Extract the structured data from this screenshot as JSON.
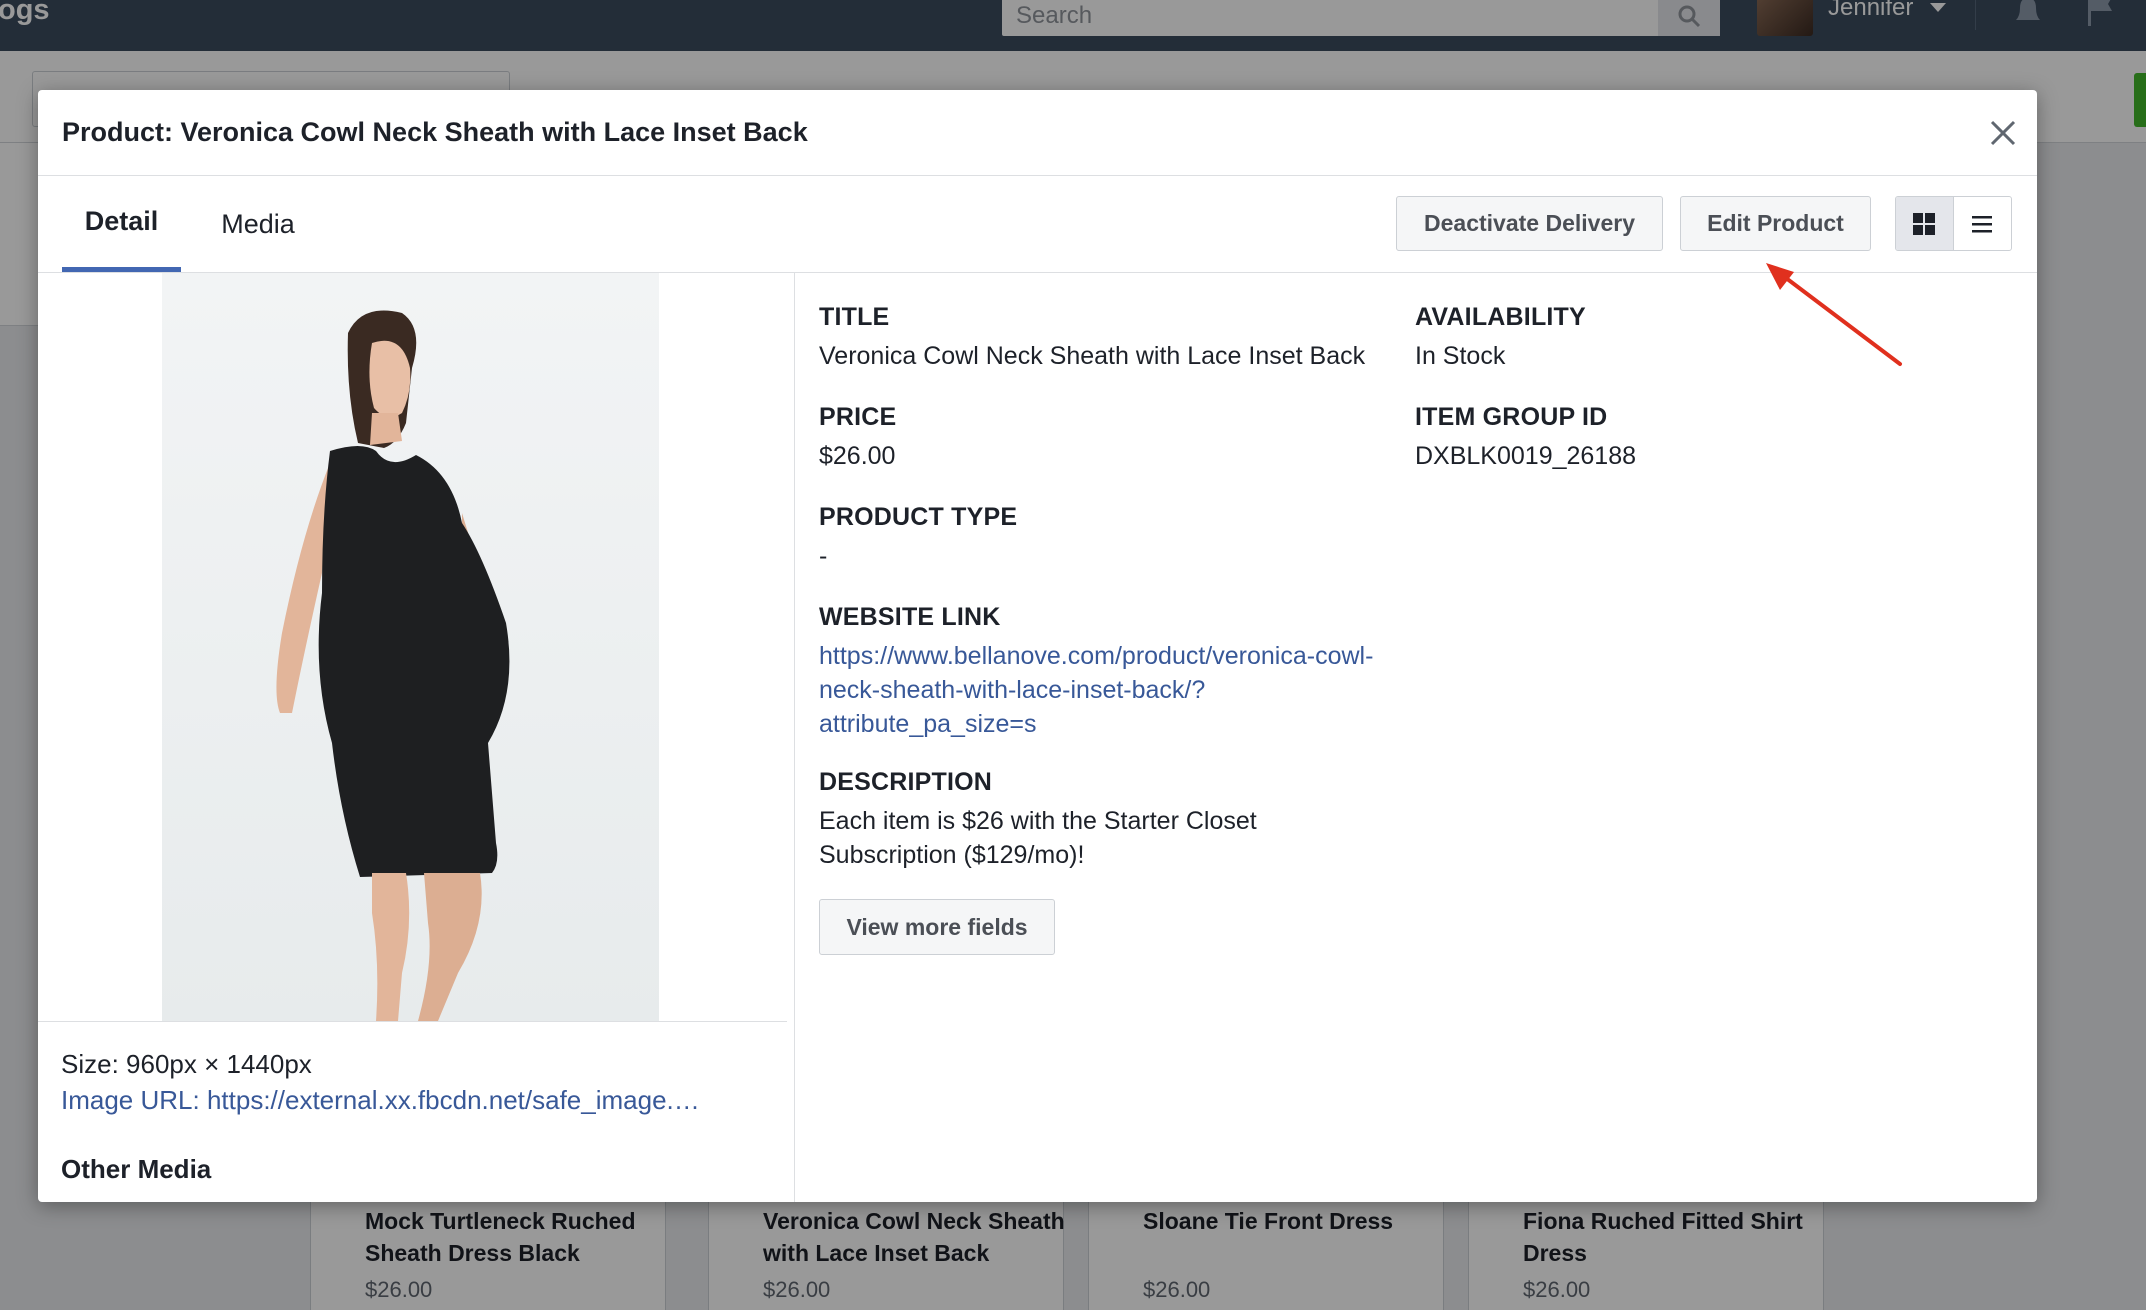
{
  "app": {
    "brand_fragment": "ogs",
    "search_placeholder": "Search",
    "user_name": "Jennifer"
  },
  "modal": {
    "title": "Product: Veronica Cowl Neck Sheath with Lace Inset Back",
    "tabs": [
      {
        "label": "Detail",
        "active": true
      },
      {
        "label": "Media",
        "active": false
      }
    ],
    "buttons": {
      "deactivate": "Deactivate Delivery",
      "edit": "Edit Product",
      "view_more": "View more fields"
    },
    "view_mode": "grid",
    "image": {
      "size_label": "Size: 960px × 1440px",
      "url_label": "Image URL: https://external.xx.fbcdn.net/safe_image.…",
      "other_media_label": "Other Media"
    },
    "fields": {
      "title_label": "TITLE",
      "title_value": "Veronica Cowl Neck Sheath with Lace Inset Back",
      "availability_label": "AVAILABILITY",
      "availability_value": "In Stock",
      "price_label": "PRICE",
      "price_value": "$26.00",
      "item_group_label": "ITEM GROUP ID",
      "item_group_value": "DXBLK0019_26188",
      "product_type_label": "PRODUCT TYPE",
      "product_type_value": "-",
      "website_label": "WEBSITE LINK",
      "website_line1": "https://www.bellanove.com/product/veronica-cowl-",
      "website_line2": "neck-sheath-with-lace-inset-back/?",
      "website_line3": "attribute_pa_size=s",
      "description_label": "DESCRIPTION",
      "description_line1": "Each item is $26 with the Starter Closet",
      "description_line2": "Subscription ($129/mo)!"
    }
  },
  "background_cards": [
    {
      "name_line1": "Mock Turtleneck Ruched",
      "name_line2": "Sheath Dress Black",
      "price": "$26.00"
    },
    {
      "name_line1": "Veronica Cowl Neck Sheath",
      "name_line2": "with Lace Inset Back",
      "price": "$26.00"
    },
    {
      "name_line1": "Sloane Tie Front Dress",
      "name_line2": "",
      "price": "$26.00"
    },
    {
      "name_line1": "Fiona Ruched Fitted Shirt",
      "name_line2": "Dress",
      "price": "$26.00"
    }
  ],
  "colors": {
    "topbar": "#3b4b5e",
    "link": "#385898",
    "tab_active": "#4267b2",
    "annotation_arrow": "#e0301e"
  }
}
